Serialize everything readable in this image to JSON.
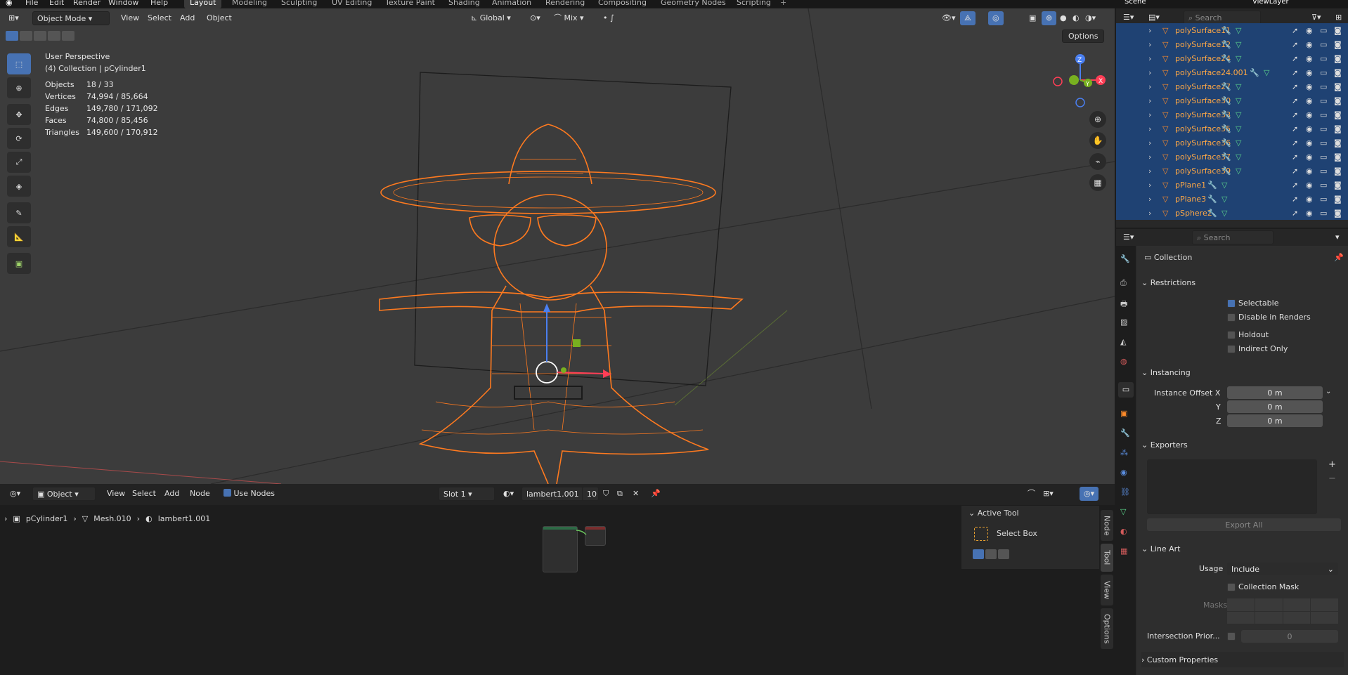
{
  "menu": {
    "file": "File",
    "edit": "Edit",
    "render": "Render",
    "window": "Window",
    "help": "Help"
  },
  "workspaces": [
    "Layout",
    "Modeling",
    "Sculpting",
    "UV Editing",
    "Texture Paint",
    "Shading",
    "Animation",
    "Rendering",
    "Compositing",
    "Geometry Nodes",
    "Scripting"
  ],
  "top_right": {
    "scene": "Scene",
    "view_layer": "ViewLayer"
  },
  "viewport": {
    "mode": "Object Mode",
    "view": "View",
    "select": "Select",
    "add": "Add",
    "object": "Object",
    "transform_orientation": "Global",
    "snap_mode": "Mix",
    "options": "Options",
    "perspective": "User Perspective",
    "collection_line": "(4) Collection | pCylinder1",
    "stats": [
      {
        "label": "Objects",
        "value": "18 / 33"
      },
      {
        "label": "Vertices",
        "value": "74,994 / 85,664"
      },
      {
        "label": "Edges",
        "value": "149,780 / 171,092"
      },
      {
        "label": "Faces",
        "value": "74,800 / 85,456"
      },
      {
        "label": "Triangles",
        "value": "149,600 / 170,912"
      }
    ],
    "gizmo": {
      "z": "Z",
      "y": "Y",
      "x": "X"
    }
  },
  "node_editor": {
    "type": "Object",
    "view": "View",
    "select": "Select",
    "add": "Add",
    "node": "Node",
    "use_nodes": "Use Nodes",
    "slot": "Slot 1",
    "material": "lambert1.001",
    "users": "10",
    "breadcrumb": [
      "pCylinder1",
      "Mesh.010",
      "lambert1.001"
    ],
    "active_tool_title": "Active Tool",
    "active_tool_name": "Select Box",
    "tabs": [
      "Node",
      "Tool",
      "View",
      "Options"
    ]
  },
  "outliner": {
    "search_placeholder": "Search",
    "rows": [
      "polySurface11",
      "polySurface12",
      "polySurface24",
      "polySurface24.001",
      "polySurface27",
      "polySurface30",
      "polySurface33",
      "polySurface35",
      "polySurface36",
      "polySurface37",
      "polySurface39",
      "pPlane1",
      "pPlane3",
      "pSphere2"
    ]
  },
  "properties": {
    "search_placeholder": "Search",
    "context": "Collection",
    "restrictions": {
      "title": "Restrictions",
      "selectable": "Selectable",
      "disable_in_renders": "Disable in Renders",
      "holdout": "Holdout",
      "indirect_only": "Indirect Only"
    },
    "instancing": {
      "title": "Instancing",
      "offset_x_label": "Instance Offset X",
      "y_label": "Y",
      "z_label": "Z",
      "x": "0 m",
      "y": "0 m",
      "z": "0 m"
    },
    "exporters": {
      "title": "Exporters",
      "export_all": "Export All"
    },
    "line_art": {
      "title": "Line Art",
      "usage_label": "Usage",
      "usage": "Include",
      "collection_mask": "Collection Mask",
      "masks": "Masks",
      "intersection_label": "Intersection Prior...",
      "intersection_value": "0"
    },
    "custom_properties": "Custom Properties"
  },
  "colors": {
    "accent": "#4772b3",
    "selected_orange": "#ff7a1f",
    "outliner_name": "#ffa845",
    "viewport_bg": "#3c3c3c"
  }
}
